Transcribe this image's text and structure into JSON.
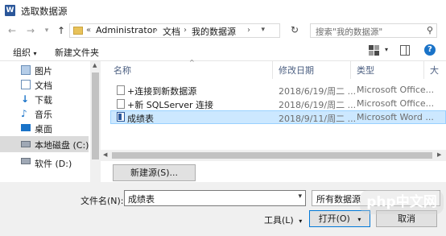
{
  "window": {
    "title": "选取数据源",
    "app_icon": "word-icon"
  },
  "nav": {
    "back": "←",
    "forward": "→",
    "up": "↑",
    "path": [
      "Administrator",
      "文档",
      "我的数据源"
    ],
    "search_placeholder": "搜索\"我的数据源\""
  },
  "toolbar": {
    "organize": "组织",
    "new_folder": "新建文件夹"
  },
  "sidebar": {
    "items": [
      {
        "label": "图片",
        "icon": "pictures-icon"
      },
      {
        "label": "文档",
        "icon": "documents-icon"
      },
      {
        "label": "下载",
        "icon": "download-icon"
      },
      {
        "label": "音乐",
        "icon": "music-icon"
      },
      {
        "label": "桌面",
        "icon": "desktop-icon"
      },
      {
        "label": "本地磁盘 (C:)",
        "icon": "drive-icon"
      },
      {
        "label": "软件 (D:)",
        "icon": "drive-icon"
      }
    ]
  },
  "columns": {
    "name": "名称",
    "date": "修改日期",
    "type": "类型",
    "size": "大"
  },
  "files": [
    {
      "name": "+连接到新数据源",
      "date": "2018/6/19/周二 ...",
      "type": "Microsoft Office..."
    },
    {
      "name": "+新 SQLServer 连接",
      "date": "2018/6/19/周二 ...",
      "type": "Microsoft Office..."
    },
    {
      "name": "成绩表",
      "date": "2018/9/11/周二 ...",
      "type": "Microsoft Word ..."
    }
  ],
  "new_source_button": "新建源(S)...",
  "filename": {
    "label": "文件名(N):",
    "value": "成绩表"
  },
  "filter": {
    "value": "所有数据源"
  },
  "actions": {
    "tools": "工具(L)",
    "open": "打开(O)",
    "cancel": "取消"
  },
  "watermark": "php中文网"
}
